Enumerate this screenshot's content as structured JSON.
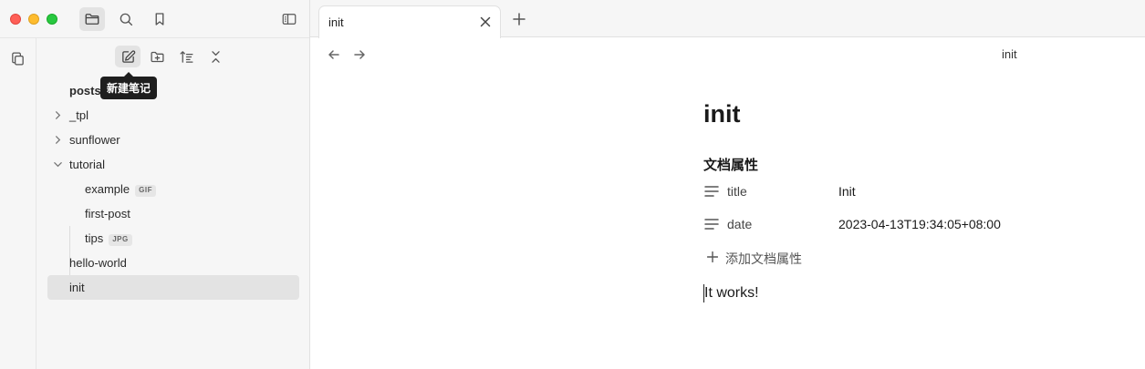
{
  "sidebar": {
    "tooltip": "新建笔记",
    "tree": {
      "root": "posts",
      "items": [
        {
          "label": "_tpl"
        },
        {
          "label": "sunflower"
        },
        {
          "label": "tutorial"
        },
        {
          "label": "example",
          "badge": "GIF"
        },
        {
          "label": "first-post"
        },
        {
          "label": "tips",
          "badge": "JPG"
        },
        {
          "label": "hello-world"
        },
        {
          "label": "init"
        }
      ]
    }
  },
  "tabs": [
    {
      "title": "init"
    }
  ],
  "view": {
    "title": "init"
  },
  "document": {
    "title": "init",
    "properties_heading": "文档属性",
    "properties": [
      {
        "key": "title",
        "value": "Init"
      },
      {
        "key": "date",
        "value": "2023-04-13T19:34:05+08:00"
      }
    ],
    "add_property": "添加文档属性",
    "body": "It works!"
  }
}
